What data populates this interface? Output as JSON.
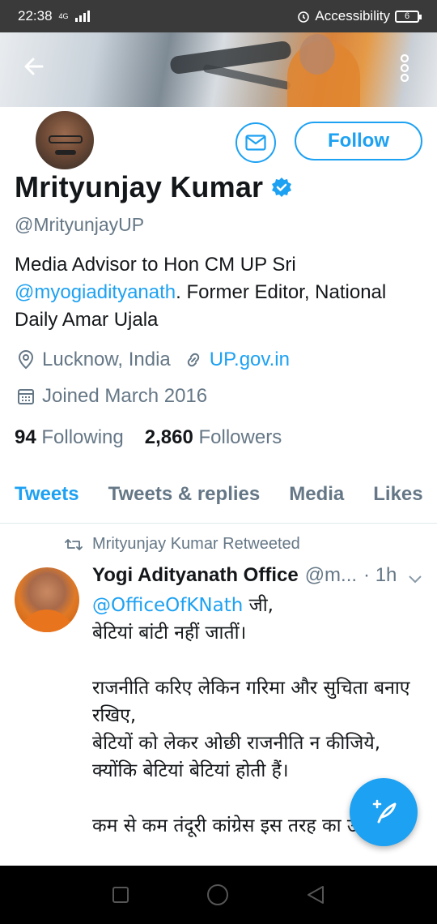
{
  "status_bar": {
    "time": "22:38",
    "network": "4G",
    "alarm_label": "Accessibility",
    "battery": "6"
  },
  "header": {
    "back_icon": "arrow-left-icon",
    "more_icon": "more-vertical-icon"
  },
  "profile": {
    "name": "Mrityunjay Kumar",
    "verified_icon": "verified-badge-icon",
    "handle": "@MrityunjayUP",
    "bio_text_1": "Media Advisor to Hon CM UP Sri ",
    "bio_link": "@myogiadityanath",
    "bio_text_2": ". Former Editor, National Daily Amar Ujala",
    "location": "Lucknow, India",
    "website": "UP.gov.in",
    "joined": "Joined March 2016",
    "following_count": "94",
    "following_label": "Following",
    "followers_count": "2,860",
    "followers_label": "Followers",
    "follow_button": "Follow",
    "message_icon": "envelope-icon"
  },
  "tabs": [
    {
      "label": "Tweets",
      "active": true
    },
    {
      "label": "Tweets & replies",
      "active": false
    },
    {
      "label": "Media",
      "active": false
    },
    {
      "label": "Likes",
      "active": false
    }
  ],
  "tweet": {
    "retweet_label": "Mrityunjay Kumar Retweeted",
    "author_name": "Yogi Adityanath Office",
    "author_handle": "@m...",
    "time": "· 1h",
    "mention": "@OfficeOfKNath",
    "mention_suffix": " जी,",
    "body": "\nबेटियां बांटी नहीं जातीं।\n\nराजनीति करिए लेकिन गरिमा और सुचिता बनाए रखिए,\nबेटियों को लेकर ओछी राजनीति न कीजिये, क्योंकि बेटियां बेटियां होती हैं।\n\nकम से कम तंदूरी कांग्रेस इस तरह का उपदेश"
  },
  "fab": {
    "icon": "compose-tweet-icon"
  },
  "colors": {
    "accent": "#1da1f2",
    "text": "#14171a",
    "secondary": "#657786"
  }
}
